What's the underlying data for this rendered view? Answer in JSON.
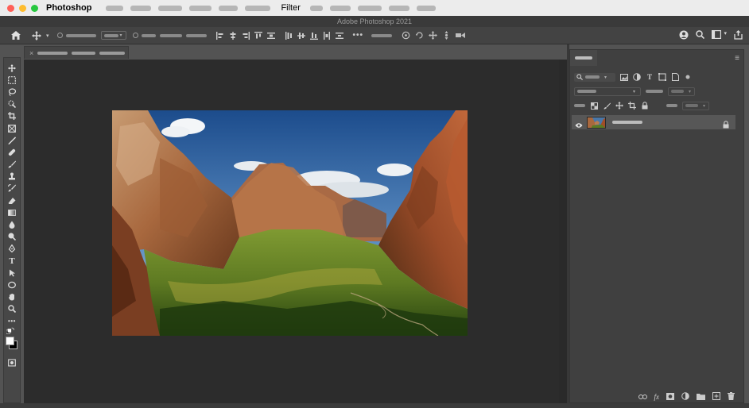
{
  "menubar": {
    "app_name": "Photoshop",
    "filter_menu": "Filter"
  },
  "window": {
    "title": "Adobe Photoshop 2021"
  },
  "colors": {
    "close": "#ff5f57",
    "minimize": "#febc2e",
    "zoom": "#28c840",
    "accent": "#1b7a86"
  },
  "toolbar": {
    "tools": [
      "move-icon",
      "marquee-icon",
      "lasso-icon",
      "quick-select-icon",
      "crop-icon",
      "frame-icon",
      "eyedropper-icon",
      "healing-brush-icon",
      "brush-icon",
      "clone-stamp-icon",
      "history-brush-icon",
      "eraser-icon",
      "gradient-icon",
      "blur-icon",
      "dodge-icon",
      "pen-icon",
      "type-icon",
      "path-select-icon",
      "ellipse-icon",
      "hand-icon",
      "zoom-icon",
      "more-tools-icon"
    ],
    "type_glyph": "T"
  },
  "layers_panel": {
    "menu_glyph": "≡"
  }
}
